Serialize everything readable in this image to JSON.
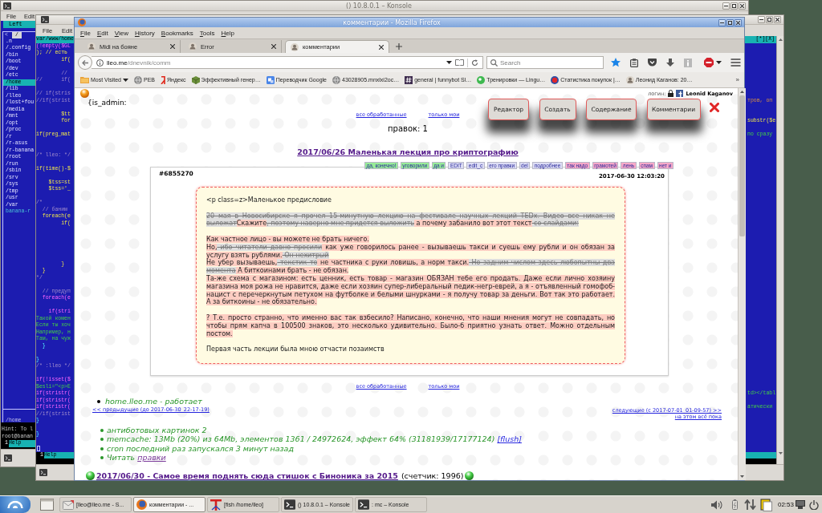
{
  "konsole_back": {
    "title": "() 10.8.0.1 – Konsole",
    "menu": [
      "File",
      "Edit"
    ],
    "panel": {
      "header": "Left",
      "history_mark": "<",
      "path": "/",
      "items": [
        {
          "name": ".n",
          "selected": false
        },
        {
          "name": "/.config",
          "selected": false
        },
        {
          "name": "/bin",
          "selected": false
        },
        {
          "name": "/boot",
          "selected": false
        },
        {
          "name": "/dev",
          "selected": false
        },
        {
          "name": "/etc",
          "selected": false
        },
        {
          "name": "/home",
          "selected": true
        },
        {
          "name": "/lib",
          "selected": false
        },
        {
          "name": "/lleo",
          "selected": false
        },
        {
          "name": "/lost+fou",
          "selected": false
        },
        {
          "name": "/media",
          "selected": false
        },
        {
          "name": "/mnt",
          "selected": false
        },
        {
          "name": "/opt",
          "selected": false
        },
        {
          "name": "/proc",
          "selected": false
        },
        {
          "name": "/r",
          "selected": false
        },
        {
          "name": "/r-asus",
          "selected": false
        },
        {
          "name": "/r-banana",
          "selected": false
        },
        {
          "name": "/root",
          "selected": false
        },
        {
          "name": "/run",
          "selected": false
        },
        {
          "name": "/sbin",
          "selected": false
        },
        {
          "name": "/srv",
          "selected": false
        },
        {
          "name": "/sys",
          "selected": false
        },
        {
          "name": "/tmp",
          "selected": false
        },
        {
          "name": "/usr",
          "selected": false
        },
        {
          "name": "/var",
          "selected": false
        }
      ],
      "tree_label": "banana-r",
      "current_dir": "/home"
    },
    "terminal_lines": [
      "Hint: To l",
      "root@banan"
    ],
    "keybar": [
      {
        "number": "1",
        "label": "Help"
      }
    ]
  },
  "konsole_front": {
    "menu": [
      "File",
      "Edit"
    ],
    "editor_lines": [
      {
        "kind": "header",
        "text": "var/www/home",
        "tail": {
          "kind": "header",
          "text": "[*][X]"
        }
      },
      {
        "kind": "keyword",
        "text": "(!empty($GL"
      },
      {
        "kind": "code",
        "text": "); // есть"
      },
      {
        "kind": "code",
        "text": "        if("
      },
      {
        "kind": "blank"
      },
      {
        "kind": "comment",
        "text": "        //"
      },
      {
        "kind": "comment",
        "text": "//      if("
      },
      {
        "kind": "blank"
      },
      {
        "kind": "comment",
        "text": "// if(stris"
      },
      {
        "kind": "comment",
        "text": "//if(strist",
        "tail": {
          "kind": "literal",
          "text": "тров, оп"
        }
      },
      {
        "kind": "blank"
      },
      {
        "kind": "code",
        "text": "        $tt"
      },
      {
        "kind": "code",
        "text": "        for",
        "tail": {
          "kind": "code",
          "text": "substr($e"
        }
      },
      {
        "kind": "blank"
      },
      {
        "kind": "code",
        "text": "if(preg_mat",
        "tail": {
          "kind": "string",
          "text": "по сразу"
        }
      },
      {
        "kind": "blank"
      },
      {
        "kind": "blank"
      },
      {
        "kind": "comment",
        "text": "/* lleo: */"
      },
      {
        "kind": "blank"
      },
      {
        "kind": "code",
        "text": "if(time()-$"
      },
      {
        "kind": "blank"
      },
      {
        "kind": "code",
        "text": "    $tss=st"
      },
      {
        "kind": "code",
        "text": "    $tss='_"
      },
      {
        "kind": "blank"
      },
      {
        "kind": "comment",
        "text": "/*"
      },
      {
        "kind": "comment",
        "text": "  // баним"
      },
      {
        "kind": "code",
        "text": "  foreach(e"
      },
      {
        "kind": "code",
        "text": "        if("
      },
      {
        "kind": "blank"
      },
      {
        "kind": "blank"
      },
      {
        "kind": "blank"
      },
      {
        "kind": "blank"
      },
      {
        "kind": "blank"
      },
      {
        "kind": "code",
        "text": "        }"
      },
      {
        "kind": "code",
        "text": "  }"
      },
      {
        "kind": "comment",
        "text": "*/"
      },
      {
        "kind": "blank"
      },
      {
        "kind": "comment",
        "text": "  // предуп"
      },
      {
        "kind": "keyword",
        "text": "  foreach(e"
      },
      {
        "kind": "blank"
      },
      {
        "kind": "keyword",
        "text": "    if(stri"
      },
      {
        "kind": "string",
        "text": "Такой комен"
      },
      {
        "kind": "string",
        "text": "Если ты хоч"
      },
      {
        "kind": "string",
        "text": "Например, н"
      },
      {
        "kind": "string",
        "text": "Там, на чуж"
      },
      {
        "kind": "brace",
        "text": "  }"
      },
      {
        "kind": "blank"
      },
      {
        "kind": "brace",
        "text": "}"
      },
      {
        "kind": "comment",
        "text": "/* :lleo */"
      },
      {
        "kind": "blank"
      },
      {
        "kind": "keyword",
        "text": "if(!isset($"
      },
      {
        "kind": "string",
        "text": "$esli=\"<p>E"
      },
      {
        "kind": "keyword",
        "text": "if(stristr(",
        "tail": {
          "kind": "string",
          "text": "td></tabl"
        }
      },
      {
        "kind": "keyword",
        "text": "if(stristr("
      },
      {
        "kind": "keyword",
        "text": "if(stristr(",
        "tail": {
          "kind": "string",
          "text": "атически"
        }
      },
      {
        "kind": "comment",
        "text": "//if(strist"
      },
      {
        "kind": "brace",
        "text": "}"
      },
      {
        "kind": "blank"
      },
      {
        "kind": "brace",
        "text": "}"
      },
      {
        "kind": "blank"
      },
      {
        "kind": "cursor"
      }
    ],
    "keybar": [
      {
        "number": "1",
        "label": "Help"
      }
    ]
  },
  "firefox": {
    "title": "комментарии - Mozilla Firefox",
    "menu": [
      "File",
      "Edit",
      "View",
      "History",
      "Bookmarks",
      "Tools",
      "Help"
    ],
    "tabs": [
      {
        "title": "Midi на бояне",
        "selected": false
      },
      {
        "title": "Error",
        "selected": false
      },
      {
        "title": "комментарии",
        "selected": true
      }
    ],
    "address": {
      "host": "lleo.me",
      "path": "/dnevnik/comm"
    },
    "search": {
      "placeholder": "Search"
    },
    "bookmarks": [
      {
        "label": "Most Visited",
        "kind": "folder"
      },
      {
        "label": "РЕВ",
        "kind": "globe"
      },
      {
        "label": "Яндекс",
        "kind": "mark"
      },
      {
        "label": "Эффективный генер…",
        "kind": "cube"
      },
      {
        "label": "Переводчик Google",
        "kind": "tile"
      },
      {
        "label": "43028905.mnxlxi2oc…",
        "kind": "globe"
      },
      {
        "label": "general | funnybot Sl…",
        "kind": "hash"
      },
      {
        "label": "Тренировки — Lingu…",
        "kind": "dot"
      },
      {
        "label": "Статистика покупок |…",
        "kind": "ring"
      },
      {
        "label": "Леонид Каганов: 20…",
        "kind": "avatar"
      }
    ],
    "bookmarks_overflow": "»",
    "page": {
      "admin_label": "{is_admin:",
      "login": {
        "label": "логин:",
        "user": "Leonid Kaganov"
      },
      "admin_buttons": [
        "Редактор",
        "Создать",
        "Содержание",
        "Комментарии"
      ],
      "top_links": [
        "все обработанные",
        "только мои"
      ],
      "edits": "правок: 1",
      "post_title": "2017/06/26 Маленькая лекция про криптографию",
      "tags": [
        {
          "label": "да, конечно!",
          "color": "#98ec98"
        },
        {
          "label": "уговорили",
          "color": "#98ec98"
        },
        {
          "label": "да и",
          "color": "#98ec98"
        },
        {
          "label": "EDIT",
          "color": "#dcdcf4"
        },
        {
          "label": "edit_c",
          "color": "#dcdcf4"
        },
        {
          "label": "его правки",
          "color": "#dcdcf4"
        },
        {
          "label": "del",
          "color": "#dcdcf4"
        },
        {
          "label": "подробнее",
          "color": "#dcdcf4"
        },
        {
          "label": "так надо",
          "color": "#f7a8c8"
        },
        {
          "label": "грамотей",
          "color": "#f7a8c8"
        },
        {
          "label": "лень",
          "color": "#f7a8c8"
        },
        {
          "label": "спам",
          "color": "#f7a8c8"
        },
        {
          "label": "нет и",
          "color": "#f7a8c8"
        }
      ],
      "comment": {
        "id": "#6855270",
        "date": "2017-06-30 12:03:20",
        "paragraphs": [
          {
            "lines": [
              [
                {
                  "kind": "plain",
                  "text": "<p class=z>Маленькое предисловие"
                }
              ]
            ]
          },
          {
            "lines": [
              [
                {
                  "kind": "removed",
                  "text": "20 мая в Новосибирске я прочел 15-минутную лекцию на фестивале научных лекций TEDx. Видео все никак не выложат"
                },
                {
                  "kind": "added",
                  "text": "Скажите"
                },
                {
                  "kind": "removed",
                  "text": ", поэтому наверно мне придется выложить"
                },
                {
                  "kind": "added",
                  "text": " а почему забанило вот этот текст"
                },
                {
                  "kind": "removed",
                  "text": " со слайдами:"
                }
              ]
            ]
          },
          {
            "lines": [
              [
                {
                  "kind": "added",
                  "text": "Как частное лицо - вы можете не брать ничего."
                }
              ],
              [
                {
                  "kind": "added",
                  "text": "Но,"
                },
                {
                  "kind": "removed",
                  "text": " ибо читатели давно просили"
                },
                {
                  "kind": "added",
                  "text": " как уже говорилось ранее - вызываешь такси и суешь ему рубли и он обязан за услугу взять рублями."
                },
                {
                  "kind": "removed",
                  "text": " Он нехитрый"
                }
              ],
              [
                {
                  "kind": "added",
                  "text": "Не убер вызываешь,"
                },
                {
                  "kind": "removed",
                  "text": " текстик то"
                },
                {
                  "kind": "added",
                  "text": " не частника с руки ловишь, а норм такси."
                },
                {
                  "kind": "removed",
                  "text": " Но задним числом здесь любопытны два момента"
                },
                {
                  "kind": "added",
                  "text": " А биткоинами брать - не обязан."
                }
              ],
              [
                {
                  "kind": "added",
                  "text": "Та-же схема с магазином: есть ценник, есть товар - магазин ОБЯЗАН тебе его продать. Даже если лично хозяину магазина моя рожа не нравится, даже если хозяин супер-либеральный педик-негр-еврей, а я - отъявленный гомофоб-нацист с перечеркнутым петухом на футболке и белыми шнурками - я получу товар за деньги. Вот так это работает. А за биткоины - не обязательно."
                }
              ]
            ]
          },
          {
            "lines": [
              [
                {
                  "kind": "added",
                  "text": "? Т.е. просто странно, что именно вас так взбесило? Написано, конечно, что наши мнения могут не совпадать, но чтобы прям капча в 100500 знаков, это несколько удивительно. Было-б приятно узнать ответ. Можно отдельным постом."
                }
              ]
            ]
          },
          {
            "lines": [
              [
                {
                  "kind": "plain",
                  "text": "Первая часть лекции была мною отчасти позаимств"
                }
              ]
            ]
          }
        ]
      },
      "bottom_links": [
        "все обработанные",
        "только мои"
      ],
      "server_status": "home.lleo.me - работает",
      "prev_link": "<< предыдущие (до 2017-06-30_22-17-19)",
      "next_links": [
        "следующие (с 2017-07-01_01-09-57) >>",
        "на этом всё пока"
      ],
      "stats": [
        {
          "text": "антиботовых картинок 2"
        },
        {
          "text": "memcache: 13Mb (20%) из 64Mb, элементов 1361 / 24972624, эффект 64% (31181939/17177124)",
          "link": {
            "text": "[flush]",
            "visited": false
          }
        },
        {
          "text": "cron последний раз запускался 3 минут назад"
        },
        {
          "text": "Читать",
          "link": {
            "text": "правки",
            "visited": true
          }
        }
      ],
      "next_post": {
        "title": "2017/06/30 - Самое время поднять сюда стишок с Биноника за 2015",
        "counter": "(счетчик: 1996)"
      }
    }
  },
  "taskbar": {
    "tasks": [
      {
        "label": "[lleo@lleo.me - S...",
        "kind": "mail",
        "selected": false
      },
      {
        "label": "комментарии - ...",
        "kind": "browser",
        "selected": true
      },
      {
        "label": "[fish /home/lleo]",
        "kind": "text",
        "selected": false
      },
      {
        "label": "() 10.8.0.1 – Konsole",
        "kind": "terminal",
        "selected": false
      },
      {
        "label": ": mc – Konsole",
        "kind": "terminal",
        "selected": false
      }
    ],
    "clock": "02:53"
  }
}
